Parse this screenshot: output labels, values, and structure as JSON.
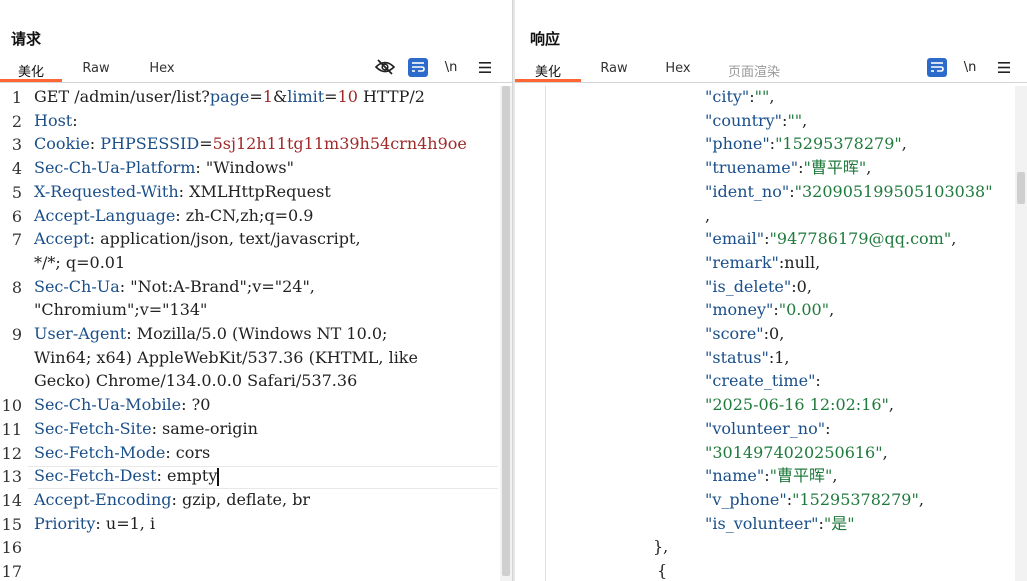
{
  "request": {
    "title": "请求",
    "tabs": [
      "美化",
      "Raw",
      "Hex"
    ],
    "active_tab": "美化",
    "lines": [
      {
        "n": "1",
        "parts": [
          [
            "plain",
            "GET /admin/user/list?"
          ],
          [
            "key",
            "page"
          ],
          [
            "plain",
            "="
          ],
          [
            "cookie",
            "1"
          ],
          [
            "plain",
            "&"
          ],
          [
            "key",
            "limit"
          ],
          [
            "plain",
            "="
          ],
          [
            "cookie",
            "10"
          ],
          [
            "plain",
            " HTTP/2"
          ]
        ]
      },
      {
        "n": "2",
        "parts": [
          [
            "key",
            "Host"
          ],
          [
            "plain",
            ":"
          ]
        ]
      },
      {
        "n": "3",
        "parts": [
          [
            "key",
            "Cookie"
          ],
          [
            "plain",
            ": "
          ],
          [
            "key",
            "PHPSESSID"
          ],
          [
            "plain",
            "="
          ],
          [
            "cookie",
            "5sj12h11tg11m39h54crn4h9oe"
          ]
        ]
      },
      {
        "n": "4",
        "parts": [
          [
            "key",
            "Sec-Ch-Ua-Platform"
          ],
          [
            "plain",
            ": \"Windows\""
          ]
        ]
      },
      {
        "n": "5",
        "parts": [
          [
            "key",
            "X-Requested-With"
          ],
          [
            "plain",
            ": XMLHttpRequest"
          ]
        ]
      },
      {
        "n": "6",
        "parts": [
          [
            "key",
            "Accept-Language"
          ],
          [
            "plain",
            ": zh-CN,zh;q=0.9"
          ]
        ]
      },
      {
        "n": "7",
        "parts": [
          [
            "key",
            "Accept"
          ],
          [
            "plain",
            ": application/json, text/javascript,"
          ]
        ]
      },
      {
        "n": "",
        "parts": [
          [
            "plain",
            "*/*; q=0.01"
          ]
        ]
      },
      {
        "n": "8",
        "parts": [
          [
            "key",
            "Sec-Ch-Ua"
          ],
          [
            "plain",
            ": \"Not:A-Brand\";v=\"24\","
          ]
        ]
      },
      {
        "n": "",
        "parts": [
          [
            "plain",
            "\"Chromium\";v=\"134\""
          ]
        ]
      },
      {
        "n": "9",
        "parts": [
          [
            "key",
            "User-Agent"
          ],
          [
            "plain",
            ": Mozilla/5.0 (Windows NT 10.0;"
          ]
        ]
      },
      {
        "n": "",
        "parts": [
          [
            "plain",
            "Win64; x64) AppleWebKit/537.36 (KHTML, like"
          ]
        ]
      },
      {
        "n": "",
        "parts": [
          [
            "plain",
            "Gecko) Chrome/134.0.0.0 Safari/537.36"
          ]
        ]
      },
      {
        "n": "10",
        "parts": [
          [
            "key",
            "Sec-Ch-Ua-Mobile"
          ],
          [
            "plain",
            ": ?0"
          ]
        ]
      },
      {
        "n": "11",
        "parts": [
          [
            "key",
            "Sec-Fetch-Site"
          ],
          [
            "plain",
            ": same-origin"
          ]
        ]
      },
      {
        "n": "12",
        "parts": [
          [
            "key",
            "Sec-Fetch-Mode"
          ],
          [
            "plain",
            ": cors"
          ]
        ]
      },
      {
        "n": "13",
        "parts": [
          [
            "key",
            "Sec-Fetch-Dest"
          ],
          [
            "plain",
            ": empty"
          ]
        ]
      },
      {
        "n": "14",
        "parts": [
          [
            "key",
            "Accept-Encoding"
          ],
          [
            "plain",
            ": gzip, deflate, br"
          ]
        ]
      },
      {
        "n": "15",
        "parts": [
          [
            "key",
            "Priority"
          ],
          [
            "plain",
            ": u=1, i"
          ]
        ]
      },
      {
        "n": "16",
        "parts": []
      },
      {
        "n": "17",
        "parts": []
      }
    ]
  },
  "response": {
    "title": "响应",
    "tabs": [
      "美化",
      "Raw",
      "Hex",
      "页面渲染"
    ],
    "active_tab": "美化",
    "lines": [
      {
        "indent": 158,
        "parts": [
          [
            "key",
            "\"city\""
          ],
          [
            "plain",
            ":"
          ],
          [
            "str",
            "\"\""
          ],
          [
            "plain",
            ","
          ]
        ]
      },
      {
        "indent": 158,
        "parts": [
          [
            "key",
            "\"country\""
          ],
          [
            "plain",
            ":"
          ],
          [
            "str",
            "\"\""
          ],
          [
            "plain",
            ","
          ]
        ]
      },
      {
        "indent": 158,
        "parts": [
          [
            "key",
            "\"phone\""
          ],
          [
            "plain",
            ":"
          ],
          [
            "str",
            "\"15295378279\""
          ],
          [
            "plain",
            ","
          ]
        ]
      },
      {
        "indent": 158,
        "parts": [
          [
            "key",
            "\"truename\""
          ],
          [
            "plain",
            ":"
          ],
          [
            "str",
            "\"曹平晖\""
          ],
          [
            "plain",
            ","
          ]
        ]
      },
      {
        "indent": 158,
        "parts": [
          [
            "key",
            "\"ident_no\""
          ],
          [
            "plain",
            ":"
          ],
          [
            "str",
            "\"320905199505103038\""
          ]
        ]
      },
      {
        "indent": 158,
        "parts": [
          [
            "plain",
            ","
          ]
        ]
      },
      {
        "indent": 158,
        "parts": [
          [
            "key",
            "\"email\""
          ],
          [
            "plain",
            ":"
          ],
          [
            "str",
            "\"947786179@qq.com\""
          ],
          [
            "plain",
            ","
          ]
        ]
      },
      {
        "indent": 158,
        "parts": [
          [
            "key",
            "\"remark\""
          ],
          [
            "plain",
            ":null,"
          ]
        ]
      },
      {
        "indent": 158,
        "parts": [
          [
            "key",
            "\"is_delete\""
          ],
          [
            "plain",
            ":0,"
          ]
        ]
      },
      {
        "indent": 158,
        "parts": [
          [
            "key",
            "\"money\""
          ],
          [
            "plain",
            ":"
          ],
          [
            "str",
            "\"0.00\""
          ],
          [
            "plain",
            ","
          ]
        ]
      },
      {
        "indent": 158,
        "parts": [
          [
            "key",
            "\"score\""
          ],
          [
            "plain",
            ":0,"
          ]
        ]
      },
      {
        "indent": 158,
        "parts": [
          [
            "key",
            "\"status\""
          ],
          [
            "plain",
            ":1,"
          ]
        ]
      },
      {
        "indent": 158,
        "parts": [
          [
            "key",
            "\"create_time\""
          ],
          [
            "plain",
            ":"
          ]
        ]
      },
      {
        "indent": 158,
        "parts": [
          [
            "str",
            "\"2025-06-16 12:02:16\""
          ],
          [
            "plain",
            ","
          ]
        ]
      },
      {
        "indent": 158,
        "parts": [
          [
            "key",
            "\"volunteer_no\""
          ],
          [
            "plain",
            ":"
          ]
        ]
      },
      {
        "indent": 158,
        "parts": [
          [
            "str",
            "\"3014974020250616\""
          ],
          [
            "plain",
            ","
          ]
        ]
      },
      {
        "indent": 158,
        "parts": [
          [
            "key",
            "\"name\""
          ],
          [
            "plain",
            ":"
          ],
          [
            "str",
            "\"曹平晖\""
          ],
          [
            "plain",
            ","
          ]
        ]
      },
      {
        "indent": 158,
        "parts": [
          [
            "key",
            "\"v_phone\""
          ],
          [
            "plain",
            ":"
          ],
          [
            "str",
            "\"15295378279\""
          ],
          [
            "plain",
            ","
          ]
        ]
      },
      {
        "indent": 158,
        "parts": [
          [
            "key",
            "\"is_volunteer\""
          ],
          [
            "plain",
            ":"
          ],
          [
            "str",
            "\"是\""
          ]
        ]
      },
      {
        "indent": 106,
        "parts": [
          [
            "plain",
            "},"
          ]
        ]
      },
      {
        "indent": 110,
        "parts": [
          [
            "plain",
            "{"
          ]
        ]
      }
    ]
  },
  "icons": {
    "hide": "eye-slash-icon",
    "wrap": "word-wrap-icon",
    "newline": "\\n",
    "menu": "hamburger-menu-icon"
  },
  "colors": {
    "accent": "#ff6633",
    "blue_button": "#2c6bc9",
    "header_key": "#1a4f8a",
    "cookie_value": "#a02a2a",
    "string_value": "#1f7a3c"
  }
}
